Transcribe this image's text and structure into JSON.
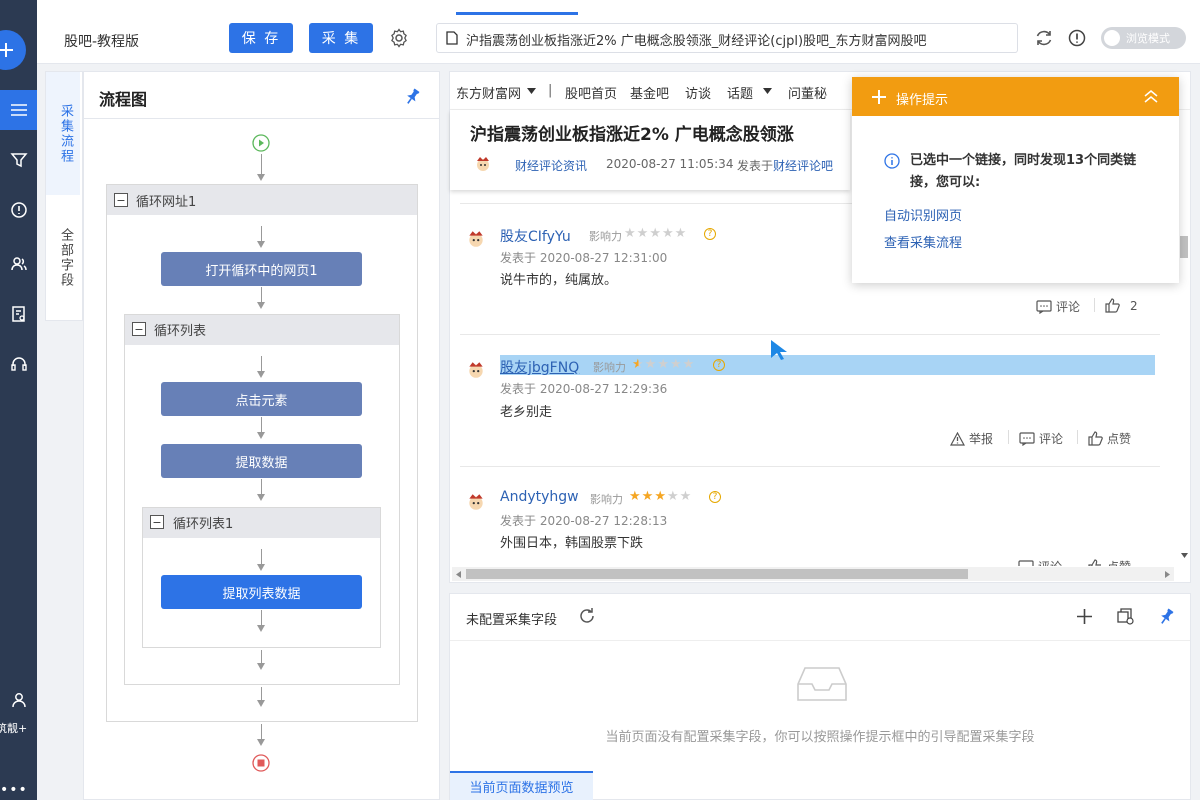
{
  "sidebar": {
    "user_label": "筑靓+",
    "more": "•••"
  },
  "toolbar": {
    "task_name": "股吧-教程版",
    "save_label": "保 存",
    "collect_label": "采 集",
    "url": "沪指震荡创业板指涨近2% 广电概念股领涨_财经评论(cjpl)股吧_东方财富网股吧",
    "browse_mode_label": "浏览模式"
  },
  "side_tabs": {
    "workflow": "采集流程",
    "all_fields": "全部字段"
  },
  "flow": {
    "title": "流程图",
    "loop_url": "循环网址1",
    "open_page": "打开循环中的网页1",
    "loop_list": "循环列表",
    "click_element": "点击元素",
    "extract_data": "提取数据",
    "loop_list1": "循环列表1",
    "extract_list_data": "提取列表数据"
  },
  "web": {
    "nav": [
      "东方财富网",
      "股吧首页",
      "基金吧",
      "访谈",
      "话题",
      "问董秘"
    ],
    "nav_sep": "|",
    "article": {
      "title": "沪指震荡创业板指涨近2% 广电概念股领涨",
      "source": "财经评论资讯",
      "time": "2020-08-27 11:05:34",
      "pub_prefix": "发表于",
      "pub_link": "财经评论吧"
    },
    "influence_label": "影响力",
    "comments": [
      {
        "user": "股友CIfyYu",
        "rating": 0,
        "time": "发表于 2020-08-27 12:31:00",
        "text": "说牛市的，纯属放。",
        "comment_label": "评论",
        "like_count": "2"
      },
      {
        "user": "股友jbgFNQ",
        "rating": 0.5,
        "time": "发表于 2020-08-27 12:29:36",
        "text": "老乡别走",
        "report_label": "举报",
        "comment_label": "评论",
        "like_label": "点赞"
      },
      {
        "user": "Andytyhgw",
        "rating": 3,
        "time": "发表于 2020-08-27 12:28:13",
        "text": "外围日本，韩国股票下跌",
        "comment_label": "评论",
        "like_label": "点赞"
      }
    ]
  },
  "tip": {
    "title": "操作提示",
    "message": "已选中一个链接，同时发现13个同类链接，您可以:",
    "link_auto": "自动识别网页",
    "link_flow": "查看采集流程"
  },
  "fields": {
    "title": "未配置采集字段",
    "empty_message": "当前页面没有配置采集字段，你可以按照操作提示框中的引导配置采集字段",
    "preview_tab": "当前页面数据预览"
  },
  "colors": {
    "primary": "#2d73e6",
    "tip_orange": "#f29c11",
    "rail": "#2c3a52",
    "flow_node": "#6780b7",
    "star_gold": "#f5a623"
  }
}
